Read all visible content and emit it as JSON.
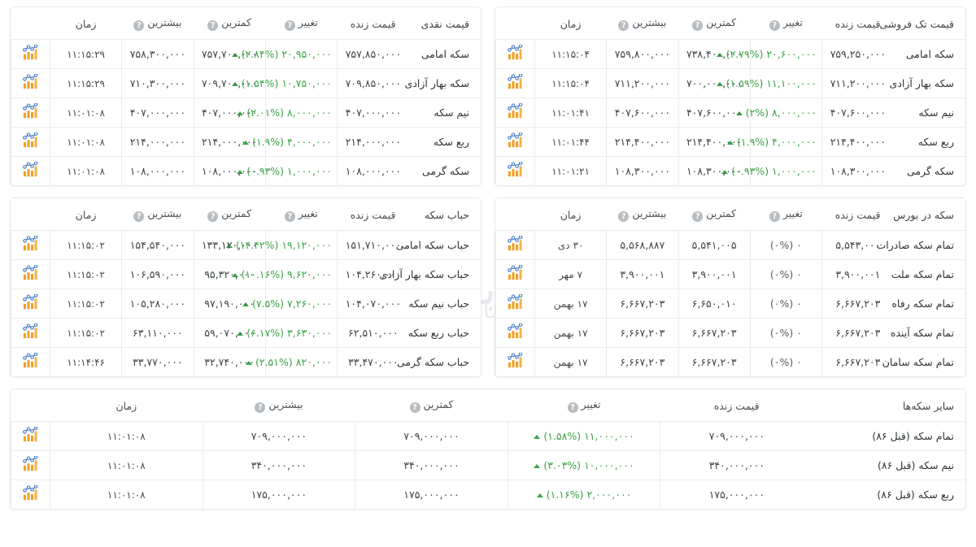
{
  "colors": {
    "up": "#3aa346",
    "flat": "#55595e",
    "border": "#ececec",
    "card_border": "#e6e8ea",
    "icon_bar": "#f0a128",
    "icon_line": "#3f77c4",
    "help_bg": "#b8bdc2"
  },
  "icons": {
    "chart": "chart-icon",
    "help": "?",
    "caret_up": "caret-up-icon"
  },
  "watermark": {
    "fa": "نبض بورس",
    "en": "nabzebourse.com"
  },
  "common_headers": {
    "live_price": "قیمت زنده",
    "change": "تغییر",
    "lowest": "کمترین",
    "highest": "بیشترین",
    "time": "زمان"
  },
  "tables": [
    {
      "id": "cash-price",
      "title": "قیمت نقدی",
      "position": "top-right",
      "rows": [
        {
          "name": "سکه امامی",
          "live": "۷۵۷,۸۵۰,۰۰۰",
          "change_amount": "۲۰,۹۵۰,۰۰۰",
          "change_pct": "(۲.۸۴%)",
          "direction": "up",
          "low": "۷۵۷,۷۰۰,۰۰۰",
          "high": "۷۵۸,۳۰۰,۰۰۰",
          "time": "۱۱:۱۵:۲۹"
        },
        {
          "name": "سکه بهار آزادی",
          "live": "۷۰۹,۸۵۰,۰۰۰",
          "change_amount": "۱۰,۷۵۰,۰۰۰",
          "change_pct": "(۱.۵۴%)",
          "direction": "up",
          "low": "۷۰۹,۷۰۰,۰۰۰",
          "high": "۷۱۰,۳۰۰,۰۰۰",
          "time": "۱۱:۱۵:۲۹"
        },
        {
          "name": "نیم سکه",
          "live": "۴۰۷,۰۰۰,۰۰۰",
          "change_amount": "۸,۰۰۰,۰۰۰",
          "change_pct": "(۲.۰۱%)",
          "direction": "up",
          "low": "۴۰۷,۰۰۰,۰۰۰",
          "high": "۴۰۷,۰۰۰,۰۰۰",
          "time": "۱۱:۰۱:۰۸"
        },
        {
          "name": "ربع سکه",
          "live": "۲۱۴,۰۰۰,۰۰۰",
          "change_amount": "۴,۰۰۰,۰۰۰",
          "change_pct": "(۱.۹%)",
          "direction": "up",
          "low": "۲۱۴,۰۰۰,۰۰۰",
          "high": "۲۱۴,۰۰۰,۰۰۰",
          "time": "۱۱:۰۱:۰۸"
        },
        {
          "name": "سکه گرمی",
          "live": "۱۰۸,۰۰۰,۰۰۰",
          "change_amount": "۱,۰۰۰,۰۰۰",
          "change_pct": "(۰.۹۳%)",
          "direction": "up",
          "low": "۱۰۸,۰۰۰,۰۰۰",
          "high": "۱۰۸,۰۰۰,۰۰۰",
          "time": "۱۱:۰۱:۰۸"
        }
      ]
    },
    {
      "id": "single-sale-price",
      "title": "قیمت تک فروشی",
      "position": "top-left",
      "rows": [
        {
          "name": "سکه امامی",
          "live": "۷۵۹,۲۵۰,۰۰۰",
          "change_amount": "۲۰,۶۰۰,۰۰۰",
          "change_pct": "(۲.۷۹%)",
          "direction": "up",
          "low": "۷۳۸,۴۰۰,۰۰۰",
          "high": "۷۵۹,۸۰۰,۰۰۰",
          "time": "۱۱:۱۵:۰۴"
        },
        {
          "name": "سکه بهار آزادی",
          "live": "۷۱۱,۲۰۰,۰۰۰",
          "change_amount": "۱۱,۱۰۰,۰۰۰",
          "change_pct": "(۱.۵۹%)",
          "direction": "up",
          "low": "۷۰۰,۰۰۰,۰۰۰",
          "high": "۷۱۱,۲۰۰,۰۰۰",
          "time": "۱۱:۱۵:۰۴"
        },
        {
          "name": "نیم سکه",
          "live": "۴۰۷,۶۰۰,۰۰۰",
          "change_amount": "۸,۰۰۰,۰۰۰",
          "change_pct": "(۲%)",
          "direction": "up",
          "low": "۴۰۷,۶۰۰,۰۰۰",
          "high": "۴۰۷,۶۰۰,۰۰۰",
          "time": "۱۱:۰۱:۴۱"
        },
        {
          "name": "ربع سکه",
          "live": "۲۱۴,۴۰۰,۰۰۰",
          "change_amount": "۴,۰۰۰,۰۰۰",
          "change_pct": "(۱.۹%)",
          "direction": "up",
          "low": "۲۱۴,۴۰۰,۰۰۰",
          "high": "۲۱۴,۴۰۰,۰۰۰",
          "time": "۱۱:۰۱:۴۴"
        },
        {
          "name": "سکه گرمی",
          "live": "۱۰۸,۳۰۰,۰۰۰",
          "change_amount": "۱,۰۰۰,۰۰۰",
          "change_pct": "(۰.۹۳%)",
          "direction": "up",
          "low": "۱۰۸,۳۰۰,۰۰۰",
          "high": "۱۰۸,۳۰۰,۰۰۰",
          "time": "۱۱:۰۱:۲۱"
        }
      ]
    },
    {
      "id": "coin-bubble",
      "title": "حباب سکه",
      "position": "middle-right",
      "rows": [
        {
          "name": "حباب سکه امامی",
          "live": "۱۵۱,۷۱۰,۰۰۰",
          "change_amount": "۱۹,۱۲۰,۰۰۰",
          "change_pct": "(۱۴.۴۲%)",
          "direction": "up",
          "low": "۱۳۳,۱۲۰,۰۰۰",
          "high": "۱۵۴,۵۴۰,۰۰۰",
          "time": "۱۱:۱۵:۰۲"
        },
        {
          "name": "حباب سکه بهار آزادی",
          "live": "۱۰۴,۲۶۰,۰۰۰",
          "change_amount": "۹,۶۲۰,۰۰۰",
          "change_pct": "(۱۰.۱۶%)",
          "direction": "up",
          "low": "۹۵,۳۲۰,۰۰۰",
          "high": "۱۰۶,۵۹۰,۰۰۰",
          "time": "۱۱:۱۵:۰۲"
        },
        {
          "name": "حباب نیم سکه",
          "live": "۱۰۴,۰۷۰,۰۰۰",
          "change_amount": "۷,۲۶۰,۰۰۰",
          "change_pct": "(۷.۵%)",
          "direction": "up",
          "low": "۹۷,۱۹۰,۰۰۰",
          "high": "۱۰۵,۲۸۰,۰۰۰",
          "time": "۱۱:۱۵:۰۲"
        },
        {
          "name": "حباب ربع سکه",
          "live": "۶۲,۵۱۰,۰۰۰",
          "change_amount": "۳,۶۳۰,۰۰۰",
          "change_pct": "(۶.۱۷%)",
          "direction": "up",
          "low": "۵۹,۰۷۰,۰۰۰",
          "high": "۶۳,۱۱۰,۰۰۰",
          "time": "۱۱:۱۵:۰۲"
        },
        {
          "name": "حباب سکه گرمی",
          "live": "۳۳,۴۷۰,۰۰۰",
          "change_amount": "۸۲۰,۰۰۰",
          "change_pct": "(۲.۵۱%)",
          "direction": "up",
          "low": "۳۲,۷۴۰,۰۰۰",
          "high": "۳۳,۷۷۰,۰۰۰",
          "time": "۱۱:۱۴:۴۶"
        }
      ]
    },
    {
      "id": "coin-in-bourse",
      "title": "سکه در بورس",
      "position": "middle-left",
      "rows": [
        {
          "name": "تمام سکه صادرات",
          "live": "۵,۵۴۳,۰۰۰",
          "change_amount": "۰",
          "change_pct": "(۰%)",
          "direction": "flat",
          "low": "۵,۵۴۱,۰۰۵",
          "high": "۵,۵۶۸,۸۸۷",
          "time": "۳۰ دی"
        },
        {
          "name": "تمام سکه ملت",
          "live": "۳,۹۰۰,۰۰۱",
          "change_amount": "۰",
          "change_pct": "(۰%)",
          "direction": "flat",
          "low": "۳,۹۰۰,۰۰۱",
          "high": "۳,۹۰۰,۰۰۱",
          "time": "۷ مهر"
        },
        {
          "name": "تمام سکه رفاه",
          "live": "۶,۶۶۷,۲۰۳",
          "change_amount": "۰",
          "change_pct": "(۰%)",
          "direction": "flat",
          "low": "۶,۶۵۰,۰۱۰",
          "high": "۶,۶۶۷,۲۰۳",
          "time": "۱۷ بهمن"
        },
        {
          "name": "تمام سکه آینده",
          "live": "۶,۶۶۷,۲۰۳",
          "change_amount": "۰",
          "change_pct": "(۰%)",
          "direction": "flat",
          "low": "۶,۶۶۷,۲۰۳",
          "high": "۶,۶۶۷,۲۰۳",
          "time": "۱۷ بهمن"
        },
        {
          "name": "تمام سکه سامان",
          "live": "۶,۶۶۷,۲۰۳",
          "change_amount": "۰",
          "change_pct": "(۰%)",
          "direction": "flat",
          "low": "۶,۶۶۷,۲۰۳",
          "high": "۶,۶۶۷,۲۰۳",
          "time": "۱۷ بهمن"
        }
      ]
    },
    {
      "id": "other-coins",
      "title": "سایر سکه‌ها",
      "position": "bottom-full",
      "rows": [
        {
          "name": "تمام سکه (قبل ۸۶)",
          "live": "۷۰۹,۰۰۰,۰۰۰",
          "change_amount": "۱۱,۰۰۰,۰۰۰",
          "change_pct": "(۱.۵۸%)",
          "direction": "up",
          "low": "۷۰۹,۰۰۰,۰۰۰",
          "high": "۷۰۹,۰۰۰,۰۰۰",
          "time": "۱۱:۰۱:۰۸"
        },
        {
          "name": "نیم سکه (قبل ۸۶)",
          "live": "۳۴۰,۰۰۰,۰۰۰",
          "change_amount": "۱۰,۰۰۰,۰۰۰",
          "change_pct": "(۳.۰۳%)",
          "direction": "up",
          "low": "۳۴۰,۰۰۰,۰۰۰",
          "high": "۳۴۰,۰۰۰,۰۰۰",
          "time": "۱۱:۰۱:۰۸"
        },
        {
          "name": "ربع سکه (قبل ۸۶)",
          "live": "۱۷۵,۰۰۰,۰۰۰",
          "change_amount": "۲,۰۰۰,۰۰۰",
          "change_pct": "(۱.۱۶%)",
          "direction": "up",
          "low": "۱۷۵,۰۰۰,۰۰۰",
          "high": "۱۷۵,۰۰۰,۰۰۰",
          "time": "۱۱:۰۱:۰۸"
        }
      ]
    }
  ]
}
